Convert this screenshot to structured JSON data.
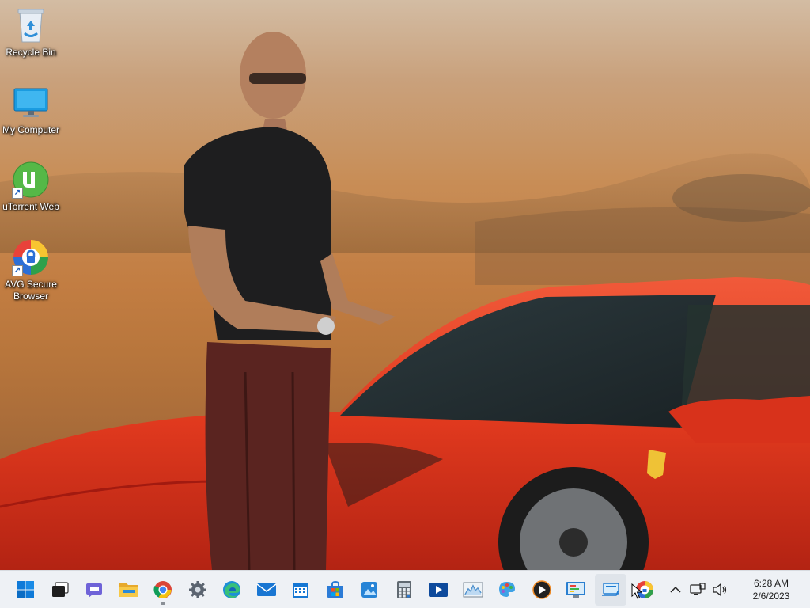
{
  "desktop": {
    "icons": [
      {
        "label": "Recycle Bin",
        "icon": "recycle-bin-icon"
      },
      {
        "label": "My Computer",
        "icon": "monitor-icon"
      },
      {
        "label": "uTorrent Web",
        "icon": "utorrent-icon",
        "shortcut": true
      },
      {
        "label": "AVG Secure Browser",
        "icon": "avg-browser-icon",
        "shortcut": true
      }
    ]
  },
  "taskbar": {
    "apps": [
      {
        "icon": "windows-start-icon"
      },
      {
        "icon": "task-view-icon"
      },
      {
        "icon": "teams-chat-icon"
      },
      {
        "icon": "file-explorer-icon"
      },
      {
        "icon": "chrome-icon",
        "active": true
      },
      {
        "icon": "settings-gear-icon"
      },
      {
        "icon": "edge-icon"
      },
      {
        "icon": "mail-icon"
      },
      {
        "icon": "calendar-icon"
      },
      {
        "icon": "microsoft-store-icon"
      },
      {
        "icon": "photos-icon"
      },
      {
        "icon": "calculator-icon"
      },
      {
        "icon": "movies-tv-icon"
      },
      {
        "icon": "resource-monitor-icon"
      },
      {
        "icon": "paint-icon"
      },
      {
        "icon": "media-player-icon"
      },
      {
        "icon": "control-panel-icon"
      },
      {
        "icon": "remote-desktop-icon",
        "hovered": true
      },
      {
        "icon": "avg-browser-icon"
      }
    ],
    "tray": {
      "icons": [
        "chevron-up-icon",
        "network-icon",
        "volume-icon"
      ],
      "time": "6:28 AM",
      "date": "2/6/2023"
    }
  },
  "colors": {
    "taskbar_bg": "#eef1f5",
    "accent": "#0067c0"
  }
}
